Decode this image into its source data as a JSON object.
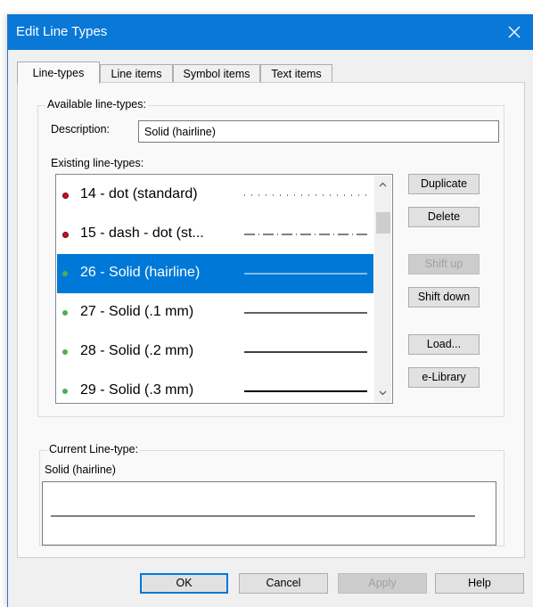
{
  "window": {
    "title": "Edit Line Types"
  },
  "tabs": [
    {
      "label": "Line-types",
      "active": true
    },
    {
      "label": "Line items"
    },
    {
      "label": "Symbol items"
    },
    {
      "label": "Text items"
    }
  ],
  "available": {
    "legend": "Available line-types:",
    "description_label": "Description:",
    "description_value": "Solid (hairline)",
    "existing_label": "Existing line-types:"
  },
  "line_types": [
    {
      "name": "14 - dot (standard)",
      "status": "red",
      "pattern": "dot"
    },
    {
      "name": "15 - dash - dot (st...",
      "status": "red",
      "pattern": "dashdot"
    },
    {
      "name": "26 - Solid (hairline)",
      "status": "green",
      "pattern": "solid-hairline",
      "selected": true
    },
    {
      "name": "27 - Solid (.1 mm)",
      "status": "green",
      "pattern": "solid"
    },
    {
      "name": "28 - Solid (.2 mm)",
      "status": "green",
      "pattern": "solid"
    },
    {
      "name": "29 - Solid (.3 mm)",
      "status": "green",
      "pattern": "solid"
    }
  ],
  "side_buttons": {
    "duplicate": "Duplicate",
    "delete": "Delete",
    "shift_up": "Shift up",
    "shift_down": "Shift down",
    "load": "Load...",
    "elibrary": "e-Library"
  },
  "current": {
    "legend": "Current Line-type:",
    "name": "Solid (hairline)"
  },
  "footer_buttons": {
    "ok": "OK",
    "cancel": "Cancel",
    "apply": "Apply",
    "help": "Help"
  },
  "colors": {
    "accent": "#0078d7",
    "titlebar": "#0a78d7",
    "status_red": "#c8102e",
    "status_green": "#4caf50"
  }
}
